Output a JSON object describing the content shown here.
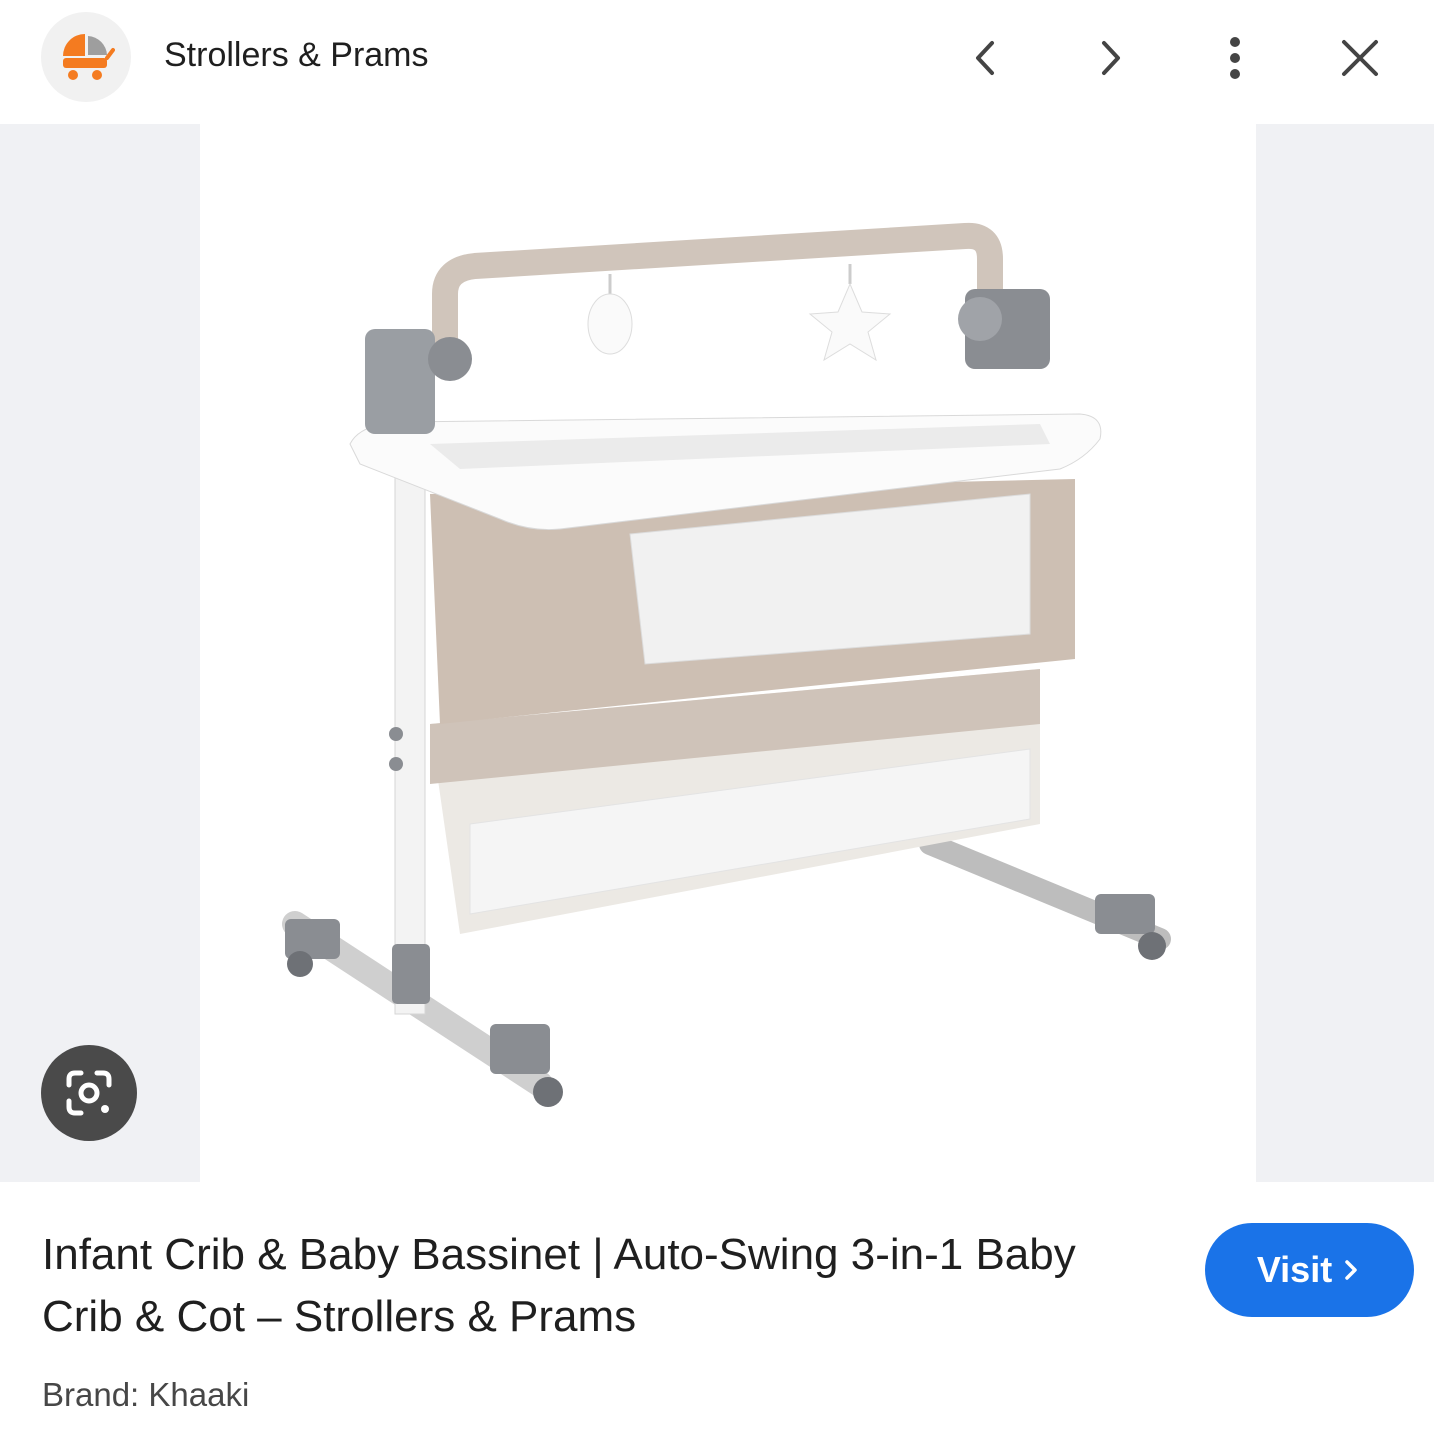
{
  "header": {
    "site_name": "Strollers & Prams",
    "site_logo_icon": "stroller-icon",
    "prev_icon": "chevron-left-icon",
    "next_icon": "chevron-right-icon",
    "more_icon": "more-vert-icon",
    "close_icon": "close-icon"
  },
  "image": {
    "subject": "bassinet-crib-product-image",
    "lens_icon": "google-lens-icon"
  },
  "result": {
    "title": "Infant Crib & Baby Bassinet | Auto-Swing 3-in-1 Baby Crib & Cot – Strollers & Prams",
    "visit_label": "Visit",
    "visit_icon": "chevron-right-icon",
    "brand": "Brand: Khaaki"
  },
  "colors": {
    "accent": "#1a73e8",
    "logo_orange": "#f47b20",
    "image_sidebar_bg": "#f0f1f4"
  }
}
